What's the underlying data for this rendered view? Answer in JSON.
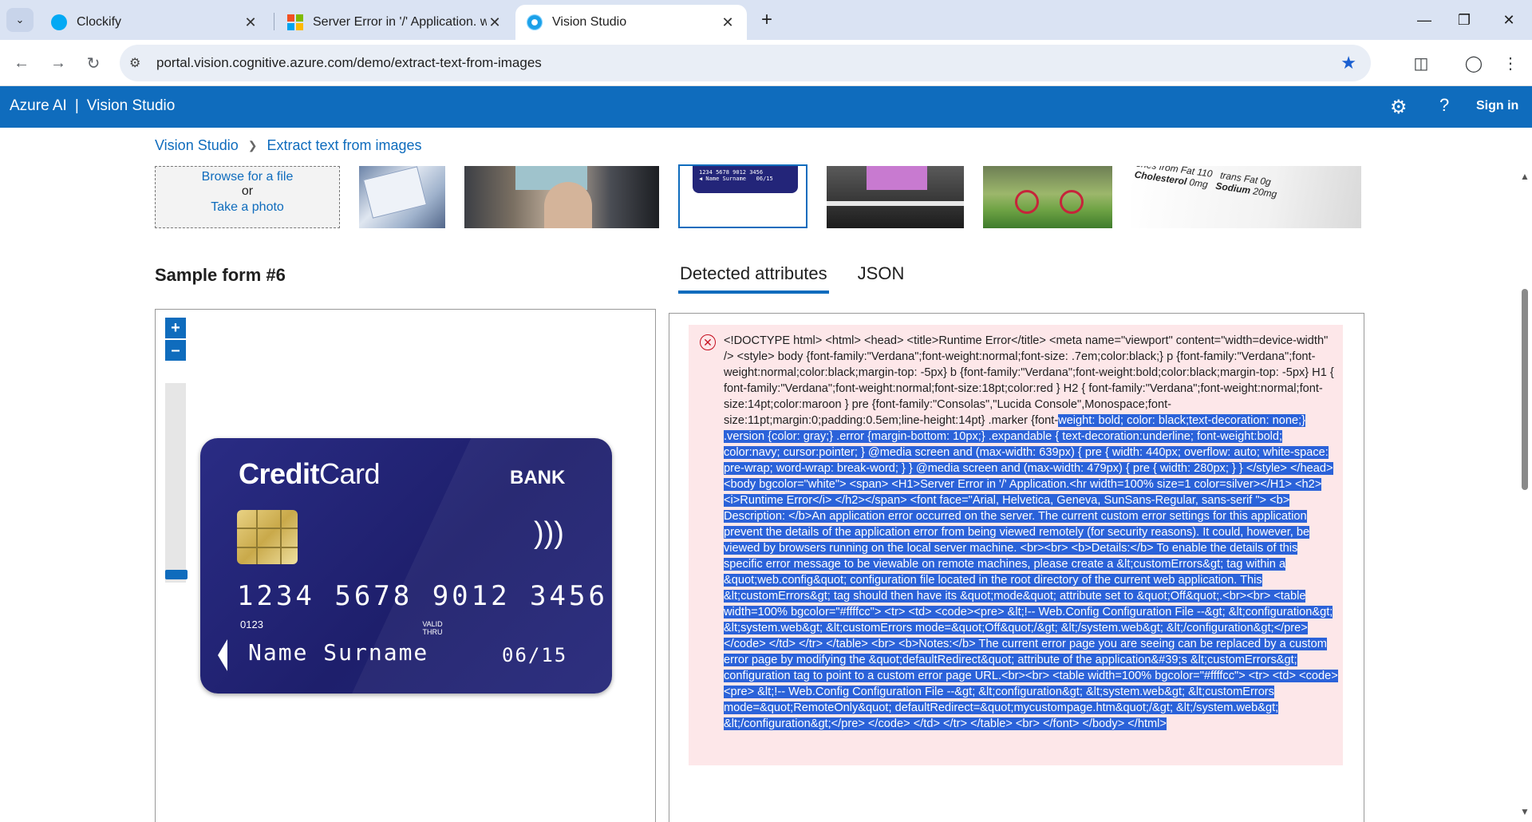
{
  "browser": {
    "tabs": [
      {
        "title": "Clockify",
        "icon": "clockify-icon",
        "color": "#03a9f4"
      },
      {
        "title": "Server Error in '/' Application. w",
        "icon": "windows-icon",
        "color": "#f25022"
      },
      {
        "title": "Vision Studio",
        "icon": "vision-studio-icon",
        "color": "#1aa0e8"
      }
    ],
    "url": "portal.vision.cognitive.azure.com/demo/extract-text-from-images"
  },
  "header": {
    "brand_left": "Azure AI",
    "brand_sep": "|",
    "brand_right": "Vision Studio",
    "signin": "Sign in",
    "color": "#0f6cbd"
  },
  "breadcrumb": {
    "root": "Vision Studio",
    "current": "Extract text from images"
  },
  "upload": {
    "browse": "Browse for a file",
    "or": "or",
    "photo": "Take a photo"
  },
  "sample": {
    "title": "Sample form #6"
  },
  "result_tabs": {
    "detected": "Detected attributes",
    "json": "JSON"
  },
  "card": {
    "brand_bold": "Credit",
    "brand_light": "Card",
    "bank": "BANK",
    "number": "1234 5678 9012 3456",
    "sub": "0123",
    "valid": "VALID THRU",
    "name": "Name Surname",
    "expiry": "06/15"
  },
  "error": {
    "plain": "<!DOCTYPE html> <html> <head> <title>Runtime Error</title> <meta name=\"viewport\" content=\"width=device-width\" /> <style> body {font-family:\"Verdana\";font-weight:normal;font-size: .7em;color:black;} p {font-family:\"Verdana\";font-weight:normal;color:black;margin-top: -5px} b {font-family:\"Verdana\";font-weight:bold;color:black;margin-top: -5px} H1 { font-family:\"Verdana\";font-weight:normal;font-size:18pt;color:red } H2 { font-family:\"Verdana\";font-weight:normal;font-size:14pt;color:maroon } pre {font-family:\"Consolas\",\"Lucida Console\",Monospace;font-size:11pt;margin:0;padding:0.5em;line-height:14pt} .marker {font-",
    "highlighted": "weight: bold; color: black;text-decoration: none;} .version {color: gray;} .error {margin-bottom: 10px;} .expandable { text-decoration:underline; font-weight:bold; color:navy; cursor:pointer; } @media screen and (max-width: 639px) { pre { width: 440px; overflow: auto; white-space: pre-wrap; word-wrap: break-word; } } @media screen and (max-width: 479px) { pre { width: 280px; } } </style> </head> <body bgcolor=\"white\"> <span> <H1>Server Error in '/' Application.<hr width=100% size=1 color=silver></H1> <h2> <i>Runtime Error</i> </h2></span> <font face=\"Arial, Helvetica, Geneva, SunSans-Regular, sans-serif \"> <b> Description: </b>An application error occurred on the server. The current custom error settings for this application prevent the details of the application error from being viewed remotely (for security reasons). It could, however, be viewed by browsers running on the local server machine. <br><br> <b>Details:</b> To enable the details of this specific error message to be viewable on remote machines, please create a &lt;customErrors&gt; tag within a &quot;web.config&quot; configuration file located in the root directory of the current web application. This &lt;customErrors&gt; tag should then have its &quot;mode&quot; attribute set to &quot;Off&quot;.<br><br> <table width=100% bgcolor=\"#ffffcc\"> <tr> <td> <code><pre> &lt;!-- Web.Config Configuration File --&gt; &lt;configuration&gt; &lt;system.web&gt; &lt;customErrors mode=&quot;Off&quot;/&gt; &lt;/system.web&gt; &lt;/configuration&gt;</pre> </code> </td> </tr> </table> <br> <b>Notes:</b> The current error page you are seeing can be replaced by a custom error page by modifying the &quot;defaultRedirect&quot; attribute of the application&#39;s &lt;customErrors&gt; configuration tag to point to a custom error page URL.<br><br> <table width=100% bgcolor=\"#ffffcc\"> <tr> <td> <code><pre> &lt;!-- Web.Config Configuration File --&gt; &lt;configuration&gt; &lt;system.web&gt; &lt;customErrors mode=&quot;RemoteOnly&quot; defaultRedirect=&quot;mycustompage.htm&quot;/&gt; &lt;/system.web&gt; &lt;/configuration&gt;</pre> </code> </td> </tr> </table> <br> </font> </body> </html>",
    "highlight_color": "#2b62d9"
  }
}
